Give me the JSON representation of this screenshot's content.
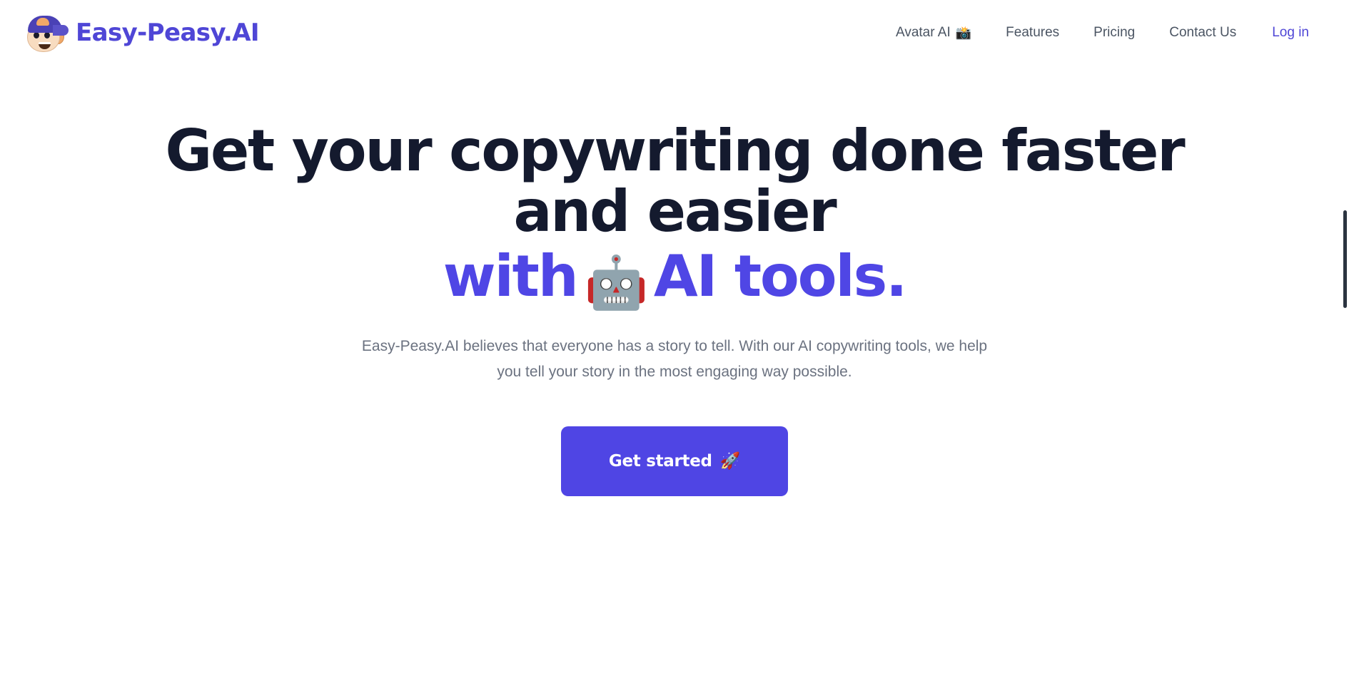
{
  "header": {
    "brand": {
      "name": "Easy-Peasy.AI",
      "logo_icon": "mascot-face-icon",
      "brand_color": "#4f46d6"
    },
    "nav": [
      {
        "label": "Avatar AI",
        "emoji": "📸",
        "emoji_name": "camera-with-flash-icon",
        "accent": false
      },
      {
        "label": "Features",
        "emoji": "",
        "emoji_name": "",
        "accent": false
      },
      {
        "label": "Pricing",
        "emoji": "",
        "emoji_name": "",
        "accent": false
      },
      {
        "label": "Contact Us",
        "emoji": "",
        "emoji_name": "",
        "accent": false
      },
      {
        "label": "Log in",
        "emoji": "",
        "emoji_name": "",
        "accent": true
      }
    ]
  },
  "hero": {
    "title_line1": "Get your copywriting done faster and easier",
    "title_accent_prefix": "with",
    "title_robot_emoji": "🤖",
    "title_accent_suffix": "AI tools.",
    "title_color": "#141a2e",
    "accent_color": "#4f46e5",
    "description": "Easy-Peasy.AI believes that everyone has a story to tell. With our AI copywriting tools, we help you tell your story in the most engaging way possible.",
    "description_color": "#6b7280",
    "cta": {
      "label": "Get started",
      "emoji": "🚀",
      "emoji_name": "rocket-icon",
      "background_color": "#4f45e4",
      "text_color": "#ffffff"
    }
  },
  "scrollbar": {
    "orientation": "vertical",
    "thumb_color": "#2b3440"
  }
}
